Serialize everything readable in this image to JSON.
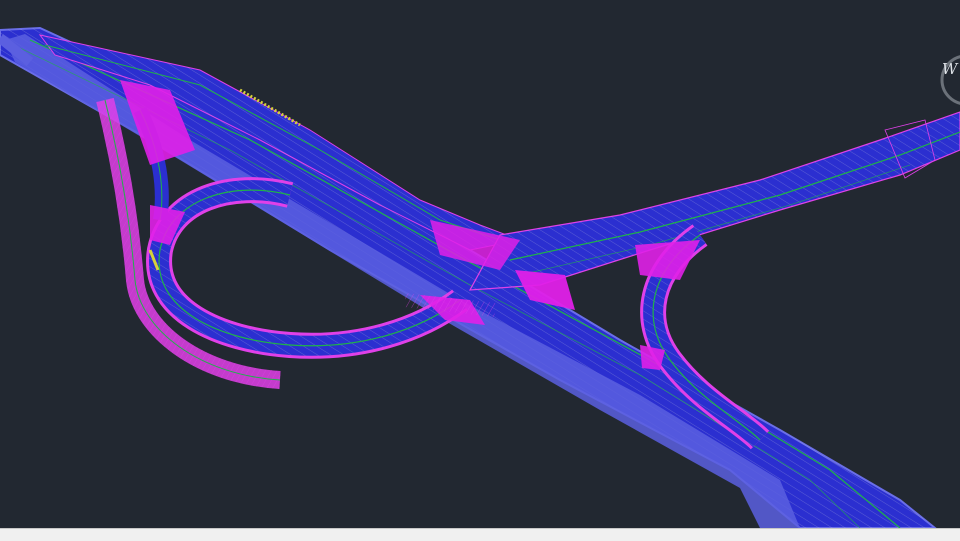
{
  "colors": {
    "background": "#222831",
    "road_fill": "#2b2fd0",
    "road_edge": "#6a6ee8",
    "ramp_outline": "#e040e8",
    "ramp_fill": "#e020e8",
    "centerline": "#1fb24a",
    "hatch": "#b8bde0",
    "accent": "#d6d23a"
  },
  "icons": {
    "nav_wheel": "navigation-wheel-icon",
    "nav_glyph": "W"
  }
}
